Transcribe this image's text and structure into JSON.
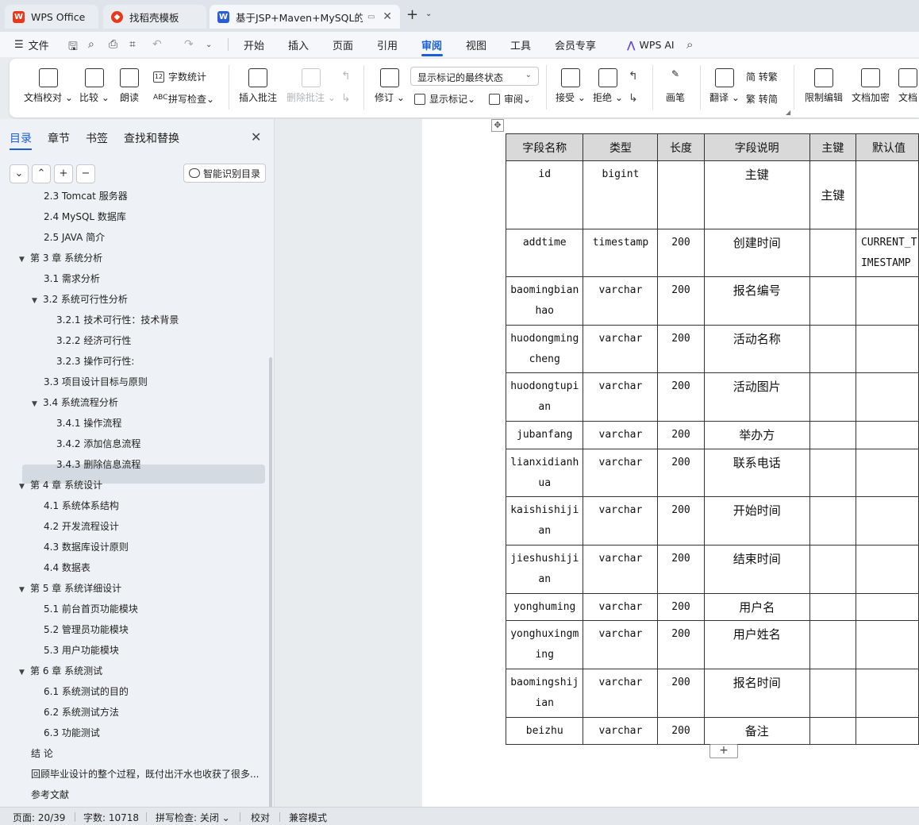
{
  "tabs": [
    {
      "label": "WPS Office",
      "icon": "wps-logo-icon",
      "color": "#e8381a"
    },
    {
      "label": "找稻壳模板",
      "icon": "docer-icon",
      "color": "#e8381a"
    },
    {
      "label": "基于JSP+Maven+MySQL的社",
      "icon": "word-doc-icon",
      "color": "#2b5dd8"
    }
  ],
  "menu": {
    "file": "文件",
    "items": [
      "开始",
      "插入",
      "页面",
      "引用",
      "审阅",
      "视图",
      "工具",
      "会员专享"
    ],
    "active": "审阅",
    "wps_ai": "WPS AI"
  },
  "ribbon": {
    "doc_check": "文档校对",
    "compare": "比较",
    "read_aloud": "朗读",
    "word_count": "字数统计",
    "spell_check": "拼写检查",
    "insert_comment": "插入批注",
    "delete_comment": "删除批注",
    "revise": "修订",
    "markup_state": "显示标记的最终状态",
    "show_markup": "显示标记",
    "review_pane": "审阅",
    "accept": "接受",
    "reject": "拒绝",
    "pen": "画笔",
    "translate": "翻译",
    "trad_to_simp": "简 转繁",
    "simp_to_trad": "繁 转简",
    "restrict_edit": "限制编辑",
    "doc_encrypt": "文档加密",
    "doc_more": "文档"
  },
  "nav": {
    "tabs": [
      "目录",
      "章节",
      "书签",
      "查找和替换"
    ],
    "active_tab": "目录",
    "smart_toc": "智能识别目录",
    "toc": [
      {
        "text": "2.3 Tomcat 服务器",
        "level": 2,
        "arrow": ""
      },
      {
        "text": "2.4 MySQL 数据库",
        "level": 2,
        "arrow": ""
      },
      {
        "text": "2.5 JAVA 简介",
        "level": 2,
        "arrow": ""
      },
      {
        "text": "第 3 章  系统分析",
        "level": 1,
        "arrow": "▼"
      },
      {
        "text": "3.1  需求分析",
        "level": 2,
        "arrow": ""
      },
      {
        "text": "3.2  系统可行性分析",
        "level": 2,
        "arrow": "▼"
      },
      {
        "text": "3.2.1 技术可行性：技术背景",
        "level": 3,
        "arrow": ""
      },
      {
        "text": "3.2.2 经济可行性",
        "level": 3,
        "arrow": ""
      },
      {
        "text": "3.2.3 操作可行性:",
        "level": 3,
        "arrow": ""
      },
      {
        "text": "3.3  项目设计目标与原则",
        "level": 2,
        "arrow": ""
      },
      {
        "text": "3.4 系统流程分析",
        "level": 2,
        "arrow": "▼"
      },
      {
        "text": "3.4.1 操作流程",
        "level": 3,
        "arrow": ""
      },
      {
        "text": "3.4.2 添加信息流程",
        "level": 3,
        "arrow": ""
      },
      {
        "text": "3.4.3 删除信息流程",
        "level": 3,
        "arrow": ""
      },
      {
        "text": "第 4 章  系统设计",
        "level": 1,
        "arrow": "▼"
      },
      {
        "text": "4.1  系统体系结构",
        "level": 2,
        "arrow": ""
      },
      {
        "text": "4.2 开发流程设计",
        "level": 2,
        "arrow": ""
      },
      {
        "text": "4.3  数据库设计原则",
        "level": 2,
        "arrow": ""
      },
      {
        "text": "4.4  数据表",
        "level": 2,
        "arrow": ""
      },
      {
        "text": "第 5 章  系统详细设计",
        "level": 1,
        "arrow": "▼"
      },
      {
        "text": "5.1 前台首页功能模块",
        "level": 2,
        "arrow": ""
      },
      {
        "text": "5.2 管理员功能模块",
        "level": 2,
        "arrow": ""
      },
      {
        "text": "5.3 用户功能模块",
        "level": 2,
        "arrow": ""
      },
      {
        "text": "第 6 章   系统测试",
        "level": 1,
        "arrow": "▼"
      },
      {
        "text": "6.1 系统测试的目的",
        "level": 2,
        "arrow": ""
      },
      {
        "text": "6.2 系统测试方法",
        "level": 2,
        "arrow": ""
      },
      {
        "text": "6.3 功能测试",
        "level": 2,
        "arrow": ""
      },
      {
        "text": "结   论",
        "level": 1,
        "arrow": ""
      },
      {
        "text": "回顾毕业设计的整个过程，既付出汗水也收获了很多...",
        "level": 1,
        "arrow": ""
      },
      {
        "text": "参考文献",
        "level": 1,
        "arrow": ""
      }
    ]
  },
  "table": {
    "headers": [
      "字段名称",
      "类型",
      "长度",
      "字段说明",
      "主键",
      "默认值"
    ],
    "rows": [
      [
        "id",
        "bigint",
        "",
        "主键",
        "主键",
        ""
      ],
      [
        "addtime",
        "timestamp",
        "200",
        "创建时间",
        "",
        "CURRENT_TIMESTAMP"
      ],
      [
        "baomingbianhao",
        "varchar",
        "200",
        "报名编号",
        "",
        ""
      ],
      [
        "huodongmingcheng",
        "varchar",
        "200",
        "活动名称",
        "",
        ""
      ],
      [
        "huodongtupian",
        "varchar",
        "200",
        "活动图片",
        "",
        ""
      ],
      [
        "jubanfang",
        "varchar",
        "200",
        "举办方",
        "",
        ""
      ],
      [
        "lianxidianhua",
        "varchar",
        "200",
        "联系电话",
        "",
        ""
      ],
      [
        "kaishishijian",
        "varchar",
        "200",
        "开始时间",
        "",
        ""
      ],
      [
        "jieshushijian",
        "varchar",
        "200",
        "结束时间",
        "",
        ""
      ],
      [
        "yonghuming",
        "varchar",
        "200",
        "用户名",
        "",
        ""
      ],
      [
        "yonghuxingming",
        "varchar",
        "200",
        "用户姓名",
        "",
        ""
      ],
      [
        "baomingshijian",
        "varchar",
        "200",
        "报名时间",
        "",
        ""
      ],
      [
        "beizhu",
        "varchar",
        "200",
        "备注",
        "",
        ""
      ]
    ]
  },
  "status": {
    "page": "页面: 20/39",
    "words": "字数: 10718",
    "spell": "拼写检查: 关闭",
    "proof": "校对",
    "compat": "兼容模式"
  },
  "colors": {
    "accent": "#1a5fd6",
    "header_fill": "#d9d9d9"
  }
}
